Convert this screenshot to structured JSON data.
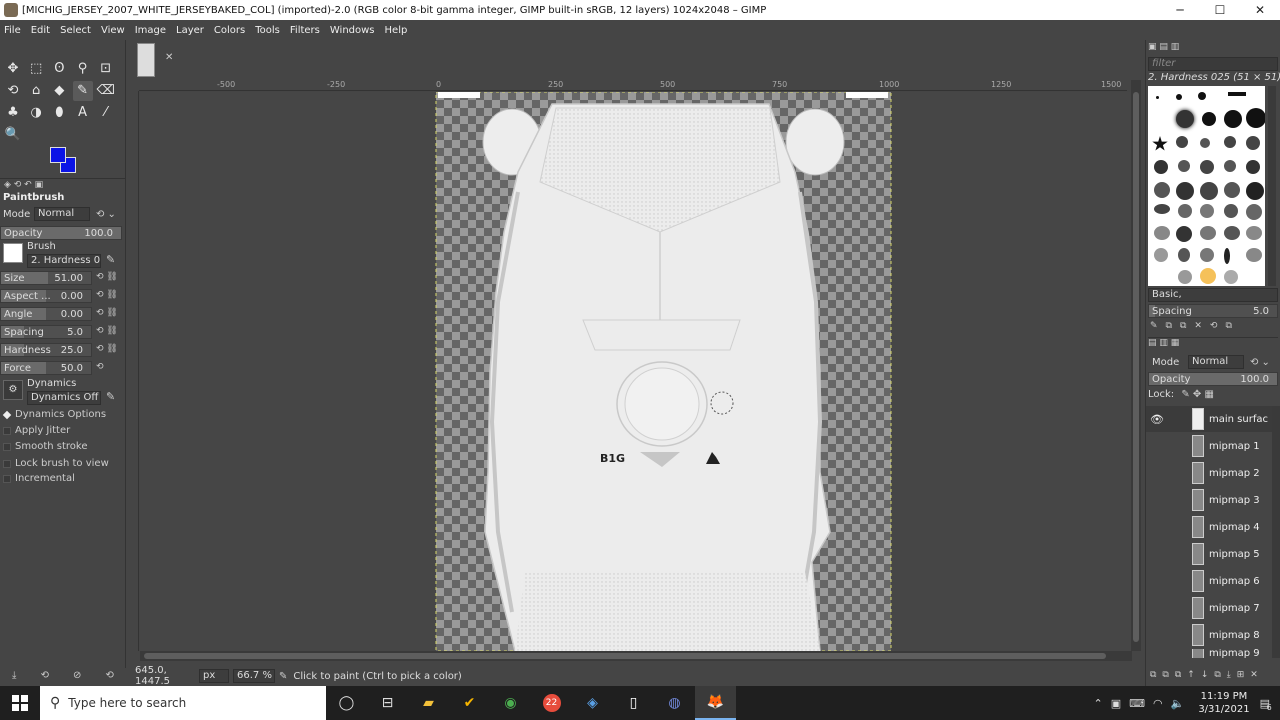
{
  "window": {
    "title": "[MICHIG_JERSEY_2007_WHITE_JERSEYBAKED_COL] (imported)-2.0 (RGB color 8-bit gamma integer, GIMP built-in sRGB, 12 layers) 1024x2048 – GIMP",
    "minimize": "─",
    "maximize": "☐",
    "close": "✕"
  },
  "menu": [
    "File",
    "Edit",
    "Select",
    "View",
    "Image",
    "Layer",
    "Colors",
    "Tools",
    "Filters",
    "Windows",
    "Help"
  ],
  "tools": [
    "✥",
    "⬚",
    "ʘ",
    "⚲",
    "⊡",
    "⟲",
    "⌂",
    "◆",
    "✎",
    "⌫",
    "♣",
    "◑",
    "⬮",
    "A",
    "⁄",
    "🔍"
  ],
  "colors": {
    "foreground": "#0b14e6",
    "background": "#0b14e6"
  },
  "tool_options": {
    "title": "Paintbrush",
    "mode_label": "Mode",
    "mode_value": "Normal",
    "opacity_label": "Opacity",
    "opacity_value": "100.0",
    "brush_label": "Brush",
    "brush_value": "2. Hardness 025",
    "size_label": "Size",
    "size_value": "51.00",
    "aspect_label": "Aspect ...",
    "aspect_value": "0.00",
    "angle_label": "Angle",
    "angle_value": "0.00",
    "spacing_label": "Spacing",
    "spacing_value": "5.0",
    "hardness_label": "Hardness",
    "hardness_value": "25.0",
    "force_label": "Force",
    "force_value": "50.0",
    "dynamics_label": "Dynamics",
    "dynamics_value": "Dynamics Off",
    "dynamics_options": "Dynamics Options",
    "apply_jitter": "Apply Jitter",
    "smooth_stroke": "Smooth stroke",
    "lock_brush": "Lock brush to view",
    "incremental": "Incremental"
  },
  "ruler": {
    "marks": [
      "-500",
      "-250",
      "0",
      "250",
      "500",
      "750",
      "1000",
      "1250",
      "1500"
    ]
  },
  "canvas": {
    "big10_text": "B1G"
  },
  "status": {
    "coords": "645.0, 1447.5",
    "unit": "px",
    "zoom": "66.7 %",
    "message": "Click to paint (Ctrl to pick a color)"
  },
  "brushes_panel": {
    "filter_placeholder": "filter",
    "current_brush": "2. Hardness 025 (51 × 51)",
    "preset_combo": "Basic,",
    "spacing_label": "Spacing",
    "spacing_value": "5.0"
  },
  "layers_panel": {
    "mode_label": "Mode",
    "mode_value": "Normal",
    "opacity_label": "Opacity",
    "opacity_value": "100.0",
    "lock_label": "Lock:",
    "layers": [
      {
        "name": "main surfac",
        "visible": true
      },
      {
        "name": "mipmap 1",
        "visible": false
      },
      {
        "name": "mipmap 2",
        "visible": false
      },
      {
        "name": "mipmap 3",
        "visible": false
      },
      {
        "name": "mipmap 4",
        "visible": false
      },
      {
        "name": "mipmap 5",
        "visible": false
      },
      {
        "name": "mipmap 6",
        "visible": false
      },
      {
        "name": "mipmap 7",
        "visible": false
      },
      {
        "name": "mipmap 8",
        "visible": false
      },
      {
        "name": "mipmap 9",
        "visible": false
      }
    ]
  },
  "taskbar": {
    "search_placeholder": "Type here to search",
    "time": "11:19 PM",
    "date": "3/31/2021",
    "notification_count": "6",
    "badge_22": "22"
  }
}
